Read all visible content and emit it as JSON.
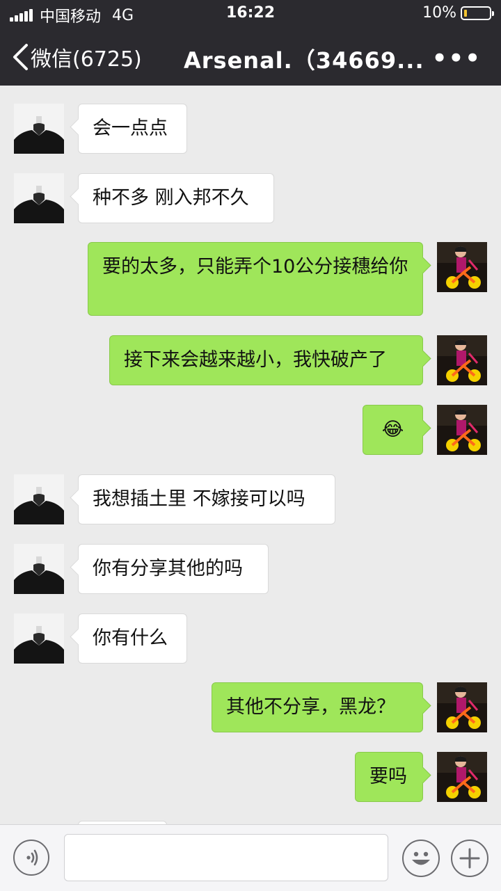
{
  "status_bar": {
    "carrier": "中国移动",
    "network": "4G",
    "time": "16:22",
    "battery_percent": "10%",
    "battery_level": 0.1,
    "battery_color": "#f4c430"
  },
  "nav": {
    "back_label": "微信(6725)",
    "title": "Arsenal.（34669...",
    "more_label": "•••"
  },
  "messages": [
    {
      "side": "left",
      "text": "会一点点"
    },
    {
      "side": "left",
      "text": "种不多 刚入邦不久"
    },
    {
      "side": "right",
      "text": "要的太多，只能弄个10公分接穗给你"
    },
    {
      "side": "right",
      "text": "接下来会越来越小，我快破产了"
    },
    {
      "side": "right",
      "text": "😂"
    },
    {
      "side": "left",
      "text": "我想插土里 不嫁接可以吗"
    },
    {
      "side": "left",
      "text": "你有分享其他的吗"
    },
    {
      "side": "left",
      "text": "你有什么"
    },
    {
      "side": "right",
      "text": "其他不分享，黑龙？"
    },
    {
      "side": "right",
      "text": "要吗"
    }
  ],
  "input_bar": {
    "voice_icon": "voice-icon",
    "emoji_icon": "emoji-icon",
    "add_icon": "add-icon",
    "text_value": ""
  },
  "colors": {
    "bar_bg": "#2b2a2f",
    "chat_bg": "#ebebeb",
    "bubble_left": "#ffffff",
    "bubble_right": "#9fe65a"
  }
}
